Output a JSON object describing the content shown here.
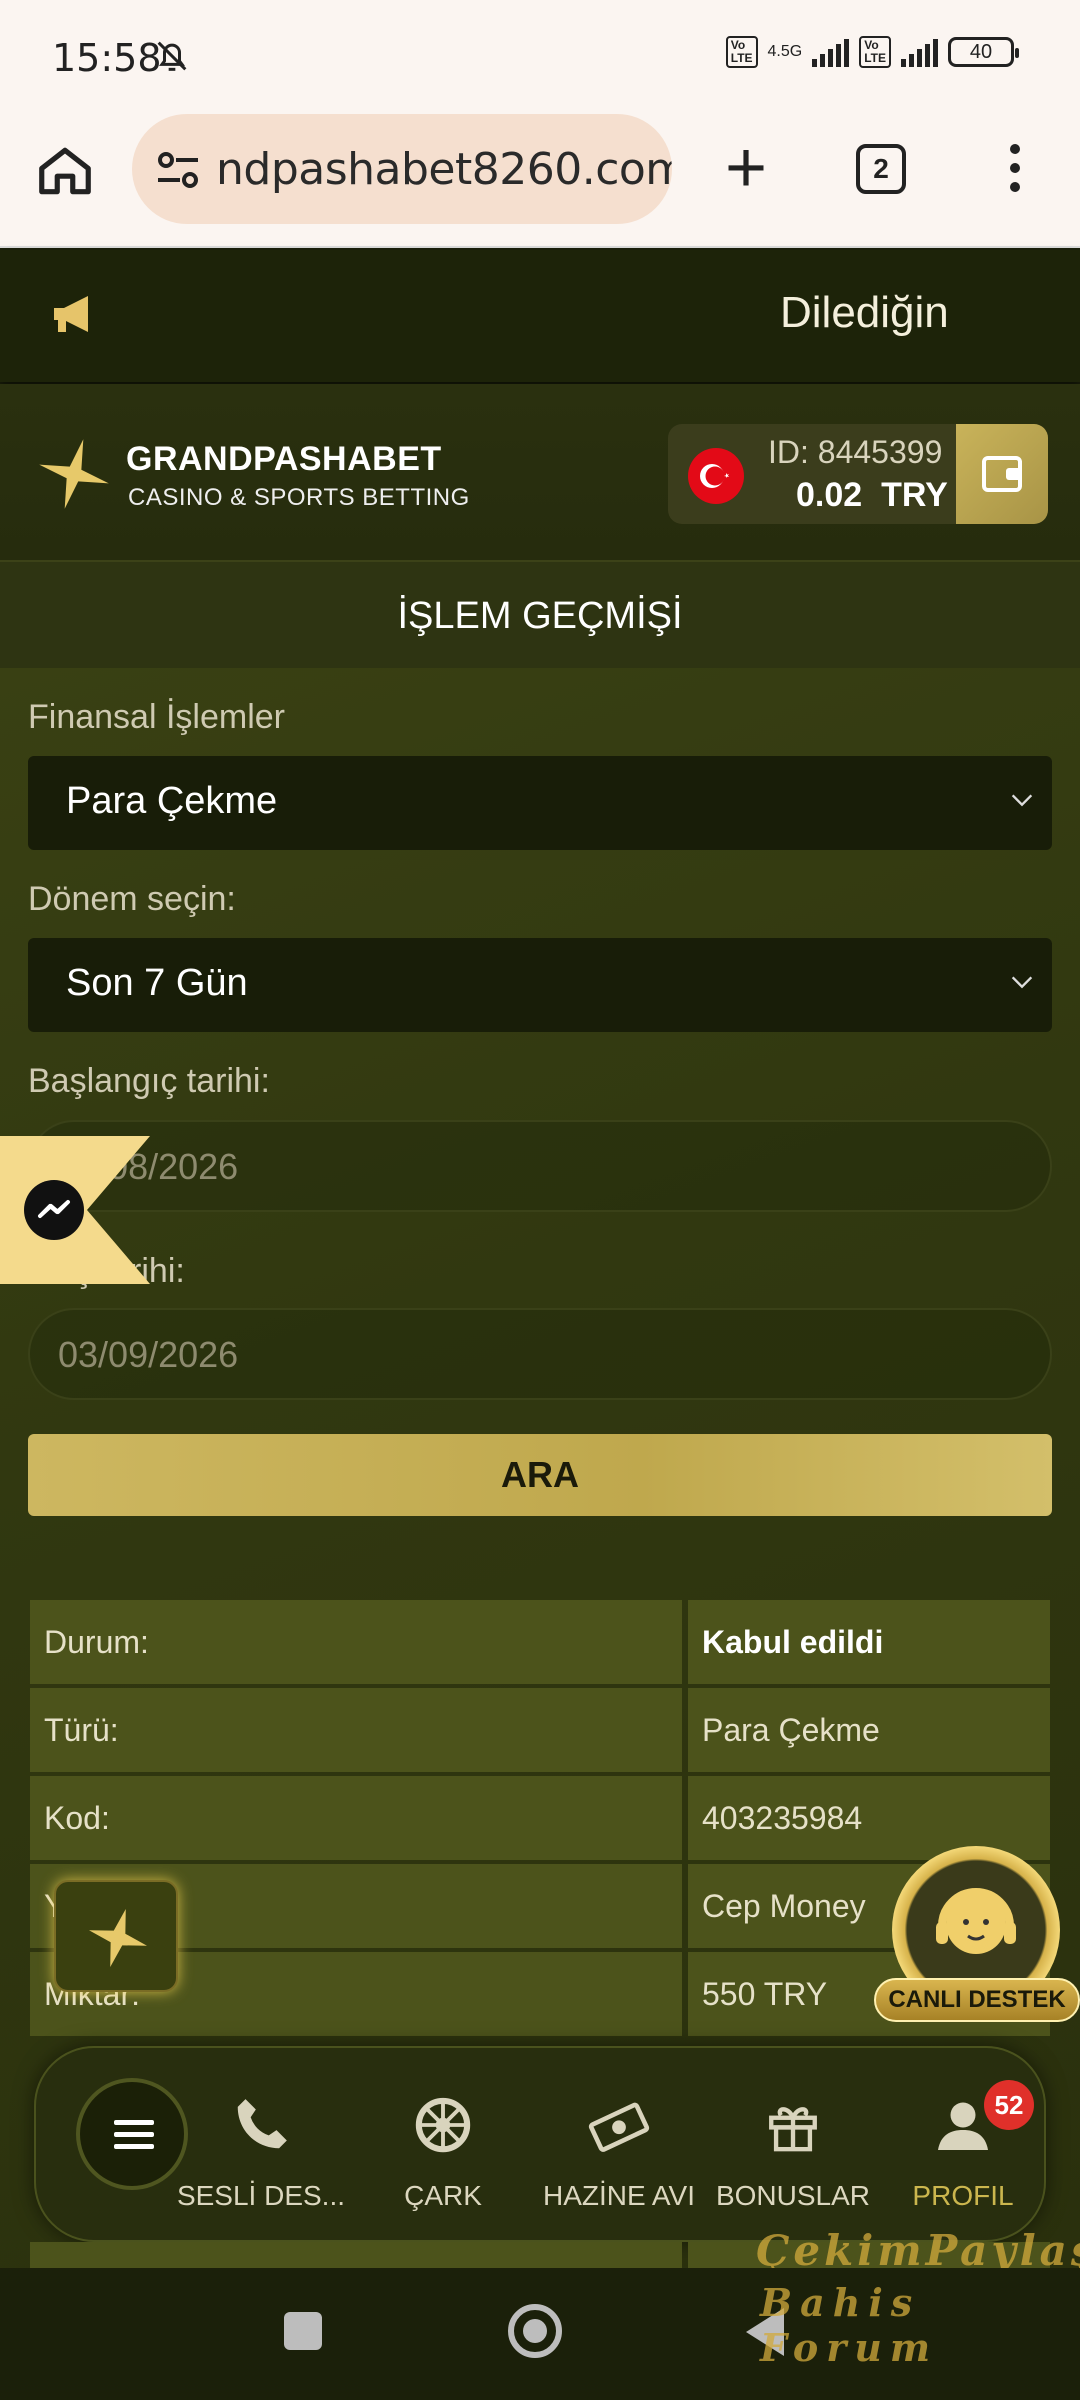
{
  "status_bar": {
    "time": "15:58",
    "network": "4.5G",
    "battery": "40"
  },
  "browser": {
    "url": "ndpashabet8260.com",
    "tab_count": "2"
  },
  "announcement": {
    "text": "Dilediğin"
  },
  "header": {
    "brand": "GRANDPASHABET",
    "tagline": "CASINO & SPORTS BETTING",
    "account_id": "ID: 8445399",
    "balance": "0.02",
    "currency": "TRY"
  },
  "page_title": "İŞLEM GEÇMİŞİ",
  "filters": {
    "type_label": "Finansal İşlemler",
    "type_value": "Para Çekme",
    "period_label": "Dönem seçin:",
    "period_value": "Son 7 Gün",
    "start_label": "Başlangıç tarihi:",
    "start_value": "03/08/2026",
    "end_label": "Bitiş tarihi:",
    "end_value": "03/09/2026",
    "search_button": "ARA"
  },
  "transaction": {
    "rows": [
      {
        "key": "Durum:",
        "value": "Kabul edildi"
      },
      {
        "key": "Türü:",
        "value": "Para Çekme"
      },
      {
        "key": "Kod:",
        "value": "403235984"
      },
      {
        "key": "Yöntem:",
        "value": "Cep Money"
      },
      {
        "key": "Miktar:",
        "value": "550 TRY"
      }
    ]
  },
  "live_support": {
    "label": "CANLI DESTEK"
  },
  "bottom_nav": {
    "items": [
      {
        "label": "SESLİ DES...",
        "icon": "phone-icon"
      },
      {
        "label": "ÇARK",
        "icon": "wheel-icon"
      },
      {
        "label": "HAZİNE AVI",
        "icon": "money-icon"
      },
      {
        "label": "BONUSLAR",
        "icon": "gift-icon"
      },
      {
        "label": "PROFIL",
        "icon": "user-icon",
        "badge": "52"
      }
    ]
  },
  "watermark": {
    "line1": "ÇekimPaylaş",
    "line2": "Bahis Forum"
  },
  "colors": {
    "accent_gold": "#cbb64e",
    "bg_olive": "#313810",
    "badge_red": "#e0302a"
  }
}
